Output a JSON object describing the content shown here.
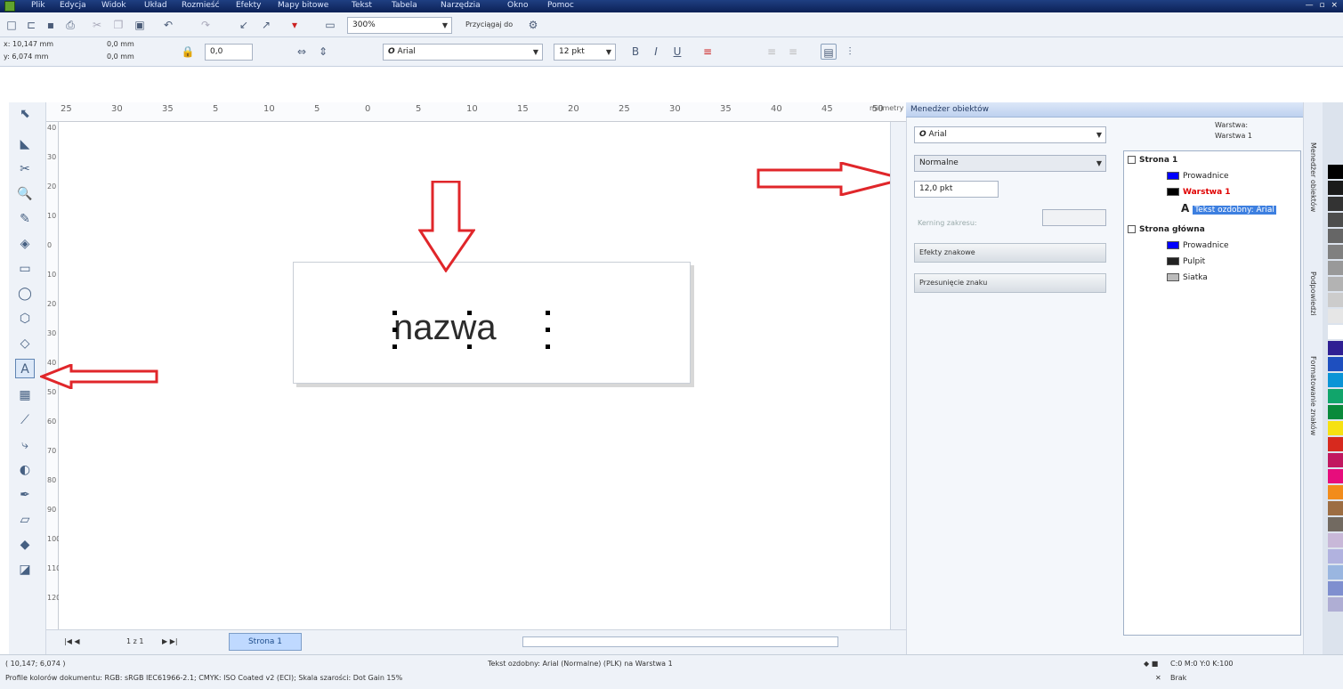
{
  "menu": [
    "Plik",
    "Edycja",
    "Widok",
    "Układ",
    "Rozmieść",
    "Efekty",
    "Mapy bitowe",
    "Tekst",
    "Tabela",
    "Narzędzia",
    "Okno",
    "Pomoc"
  ],
  "standard": {
    "zoom": "300%",
    "snap": "Przyciągaj do"
  },
  "propbar": {
    "x": "x: 10,147 mm",
    "y": "y: 6,074 mm",
    "w": "0,0 mm",
    "h": "0,0 mm",
    "angle": "0,0",
    "font": "Arial",
    "size": "12 pkt",
    "font_icon": "O"
  },
  "ruler": {
    "units": "milimetry",
    "h_ticks": [
      "25",
      "30",
      "35",
      "5",
      "10",
      "5",
      "0",
      "5",
      "10",
      "15",
      "20",
      "25",
      "30",
      "35",
      "40",
      "45",
      "50"
    ],
    "v_ticks": [
      "40",
      "30",
      "20",
      "10",
      "0",
      "10",
      "20",
      "30",
      "40",
      "50",
      "60",
      "70",
      "80",
      "90",
      "100",
      "110",
      "120"
    ]
  },
  "canvas": {
    "text": "nazwa"
  },
  "nav": {
    "pages": "1 z 1",
    "page_tab": "Strona 1"
  },
  "docker": {
    "title": "Menedżer obiektów",
    "font": "Arial",
    "style": "Normalne",
    "size": "12,0 pkt",
    "kerning": "Kerning zakresu:",
    "sections": [
      "Efekty znakowe",
      "Przesunięcie znaku"
    ],
    "layer_header": [
      "Warstwa:",
      "Warstwa 1"
    ],
    "tree": [
      {
        "label": "Strona 1",
        "level": 0,
        "bold": true,
        "color": "#000"
      },
      {
        "label": "Prowadnice",
        "level": 2,
        "bold": false,
        "color": "#0000ff"
      },
      {
        "label": "Warstwa 1",
        "level": 2,
        "bold": true,
        "color": "#ff0000"
      },
      {
        "label": "Tekst ozdobny: Arial",
        "level": 3,
        "bold": false,
        "color": "#0a6cd8"
      },
      {
        "label": "Strona główna",
        "level": 0,
        "bold": true,
        "color": "#000"
      },
      {
        "label": "Prowadnice",
        "level": 2,
        "bold": false,
        "color": "#0000ff"
      },
      {
        "label": "Pulpit",
        "level": 2,
        "bold": false,
        "color": "#222222"
      },
      {
        "label": "Siatka",
        "level": 2,
        "bold": false,
        "color": "#777777"
      }
    ]
  },
  "sidetabs": [
    "Menedżer obiektów",
    "Podpowiedzi",
    "Formatowanie znaków"
  ],
  "palette_colors": [
    "#000000",
    "#1b1b1b",
    "#333333",
    "#4d4d4d",
    "#666666",
    "#808080",
    "#999999",
    "#b3b3b3",
    "#cccccc",
    "#e6e6e6",
    "#ffffff",
    "#2f1f93",
    "#1e4fbf",
    "#0b94d6",
    "#11a56b",
    "#0a8a3b",
    "#f6e112",
    "#d7291e",
    "#c1185f",
    "#e70d7c",
    "#f28c1b",
    "#9c6d43",
    "#726a61",
    "#c8b8d8",
    "#b1b2df",
    "#9ab6e0",
    "#7f8fcf",
    "#afaed4"
  ],
  "status": {
    "coords": "( 10,147; 6,074 )",
    "object": "Tekst ozdobny: Arial (Normalne) (PLK) na Warstwa 1",
    "profile": "Profile kolorów dokumentu: RGB: sRGB IEC61966-2.1; CMYK: ISO Coated v2 (ECI); Skala szarości: Dot Gain 15%",
    "fill": "C:0 M:0 Y:0 K:100",
    "outline": "Brak"
  },
  "colors": {
    "accent": "#e0262a",
    "title": "#1f3f82"
  }
}
